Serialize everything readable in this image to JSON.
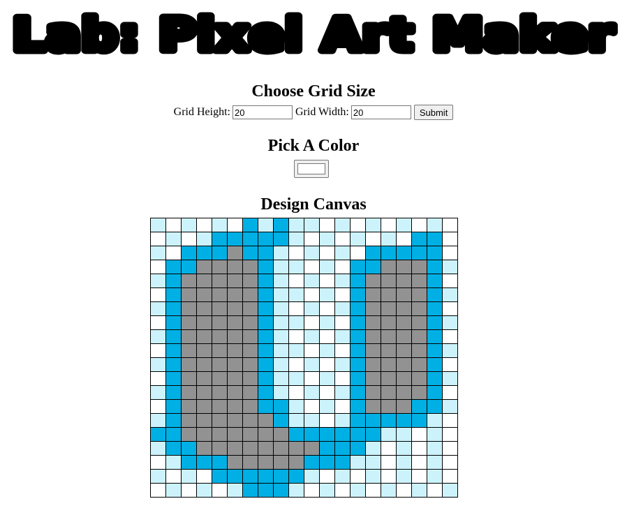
{
  "page": {
    "title": "Lab: Pixel Art Maker"
  },
  "grid_form": {
    "heading": "Choose Grid Size",
    "height_label": "Grid Height:",
    "height_value": "20",
    "width_label": "Grid Width:",
    "width_value": "20",
    "submit_label": "Submit"
  },
  "color_section": {
    "heading": "Pick A Color",
    "selected_color": "#ffffff"
  },
  "canvas_section": {
    "heading": "Design Canvas",
    "rows": 20,
    "cols": 20,
    "palette": {
      "W": "#ffffff",
      "L": "#ccf3fc",
      "B": "#00b0e4",
      "G": "#929292"
    },
    "cells": [
      "LWLWLWBLBLLWLWLWLWLW",
      "WLWLBBBBBLWLWLWLWBBW",
      "LWBBBGBBLWLWLWBBBBBW",
      "WBBGGGGBLLWLWBBGGGBL",
      "LBGGGGGBLWLWLBGGGGBW",
      "WBGGGGGBLLWLWBGGGGBL",
      "LBGGGGGBLWLWLBGGGGBW",
      "WBGGGGGBLLWLWBGGGGBL",
      "LBGGGGGBLWLWLBGGGGBW",
      "WBGGGGGBLLWLWBGGGGBL",
      "LBGGGGGBLWLWLBGGGGBW",
      "WBGGGGGBLLWLWBGGGGBL",
      "LBGGGGGBLWLWLBGGGGBW",
      "WBGGGGGBBLWLWBGGGBBL",
      "LBGGGGGGBLLWLBBBBBLW",
      "BBGGGGGGGBBBBBBLLWLW",
      "LBBGGGGGGGGBBBLWLWLW",
      "WLBBBGGGGGBBBLLWLWLW",
      "LWLWBBBBBBLWLWLWLWLW",
      "WLWLWLBBBLWLWLWLWLWL"
    ]
  }
}
